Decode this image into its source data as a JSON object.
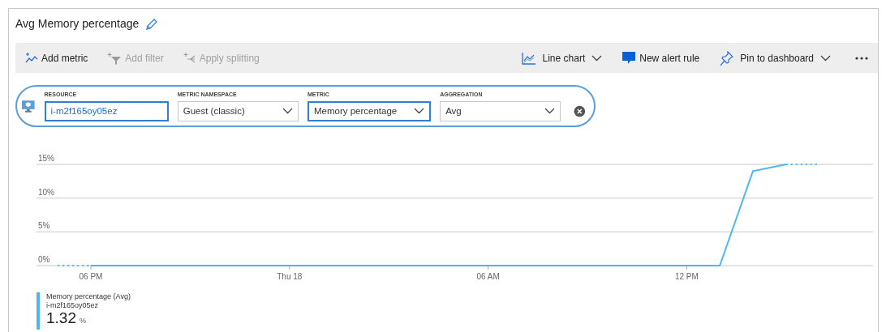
{
  "title": "Avg Memory percentage",
  "toolbar_left": [
    {
      "label": "Add metric",
      "disabled": false
    },
    {
      "label": "Add filter",
      "disabled": true
    },
    {
      "label": "Apply splitting",
      "disabled": true
    }
  ],
  "toolbar_right": [
    {
      "label": "Line chart",
      "dropdown": true
    },
    {
      "label": "New alert rule",
      "dropdown": false
    },
    {
      "label": "Pin to dashboard",
      "dropdown": true
    }
  ],
  "metric_row": {
    "fields": [
      {
        "label": "RESOURCE",
        "kind": "input",
        "value": "i-m2f165oy05ez",
        "focused": true
      },
      {
        "label": "METRIC NAMESPACE",
        "kind": "select",
        "value": "Guest (classic)",
        "focused": false
      },
      {
        "label": "METRIC",
        "kind": "select",
        "value": "Memory percentage",
        "focused": true
      },
      {
        "label": "AGGREGATION",
        "kind": "select",
        "value": "Avg",
        "focused": false
      }
    ]
  },
  "chart": {
    "chart_data": {
      "type": "line",
      "categories": [
        null,
        "06 PM",
        null,
        null,
        null,
        null,
        null,
        "Thu 18",
        null,
        null,
        null,
        null,
        null,
        "06 AM",
        null,
        null,
        null,
        null,
        null,
        "12 PM",
        null,
        null,
        null,
        null
      ],
      "series": [
        {
          "name": "Memory percentage (Avg)",
          "color": "#4db8f0",
          "values": [
            0,
            0,
            0,
            0,
            0,
            0,
            0,
            0,
            0,
            0,
            0,
            0,
            0,
            0,
            0,
            0,
            0,
            0,
            0,
            0,
            0,
            14,
            15,
            15
          ]
        }
      ],
      "ylim": [
        0,
        15
      ],
      "yticks": [
        {
          "value": 0,
          "label": "0%"
        },
        {
          "value": 5,
          "label": "5%"
        },
        {
          "value": 10,
          "label": "10%"
        },
        {
          "value": 15,
          "label": "15%"
        }
      ]
    }
  },
  "legend": {
    "resource": "i-m2f165oy05ez",
    "value": "1.32",
    "unit": "%"
  }
}
